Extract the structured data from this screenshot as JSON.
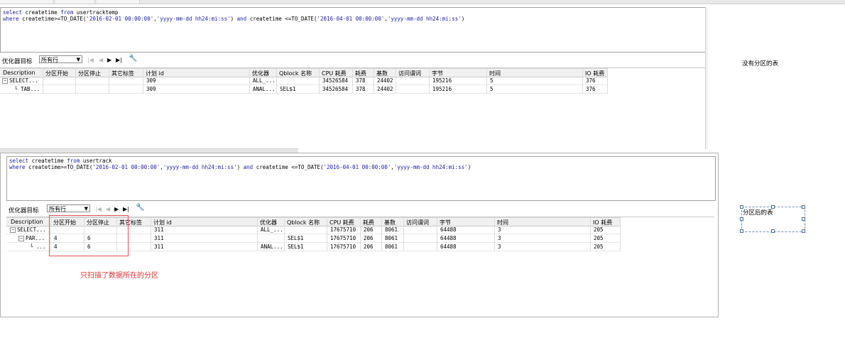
{
  "panel1": {
    "sql": {
      "line1": {
        "kw1": "select",
        "rest": " createtime ",
        "kw2": "from",
        "rest2": " usertracktemp"
      },
      "line2": {
        "kw1": "where",
        "rest": " createtime>=TO_DATE(",
        "s1": "'2016-02-01 00:00:00'",
        "c": ",",
        "s2": "'yyyy-mm-dd hh24:mi:ss'",
        "mid": ") ",
        "kw2": "and",
        "rest2": " createtime <=TO_DATE(",
        "s3": "'2016-04-01 00:00:00'",
        "c2": ",",
        "s4": "'yyyy-mm-dd hh24:mi:ss'",
        "end": ")"
      }
    },
    "toolbar": {
      "label": "优化器目标",
      "selected": "所有行"
    },
    "columns": [
      "Description",
      "分区开始",
      "分区停止",
      "其它标签",
      "计划 id",
      "优化器",
      "Qblock 名称",
      "CPU 耗费",
      "耗费",
      "基数",
      "访问谓词",
      "字节",
      "时间",
      "IO 耗费"
    ],
    "rows": [
      {
        "desc": "SELECT...",
        "start": "",
        "stop": "",
        "other": "",
        "planid": "309",
        "optimizer": "ALL_...",
        "qblock": "",
        "cpu": "34526584",
        "cost": "378",
        "card": "24402",
        "access": "",
        "bytes": "195216",
        "time": "5",
        "io": "376"
      },
      {
        "desc": "TAB...",
        "start": "",
        "stop": "",
        "other": "",
        "planid": "309",
        "optimizer": "ANAL...",
        "qblock": "SEL$1",
        "cpu": "34526584",
        "cost": "378",
        "card": "24402",
        "access": "",
        "bytes": "195216",
        "time": "5",
        "io": "376"
      }
    ],
    "side_note": "没有分区的表"
  },
  "panel2": {
    "sql": {
      "line1": {
        "kw1": "select",
        "rest": " createtime ",
        "kw2": "from",
        "rest2": " usertrack"
      },
      "line2": {
        "kw1": "where",
        "rest": " createtime>=TO_DATE(",
        "s1": "'2016-02-01 00:00:00'",
        "c": ",",
        "s2": "'yyyy-mm-dd hh24:mi:ss'",
        "mid": ") ",
        "kw2": "and",
        "rest2": " createtime <=TO_DATE(",
        "s3": "'2016-04-01 00:00:00'",
        "c2": ",",
        "s4": "'yyyy-mm-dd hh24:mi:ss'",
        "end": ")"
      }
    },
    "toolbar": {
      "label": "优化器目标",
      "selected": "所有行"
    },
    "columns": [
      "Description",
      "分区开始",
      "分区停止",
      "其它标签",
      "计划 id",
      "优化器",
      "Qblock 名称",
      "CPU 耗费",
      "耗费",
      "基数",
      "访问谓词",
      "字节",
      "时间",
      "IO 耗费"
    ],
    "rows": [
      {
        "desc": "SELECT...",
        "start": "",
        "stop": "",
        "other": "",
        "planid": "311",
        "optimizer": "ALL_...",
        "qblock": "",
        "cpu": "17675710",
        "cost": "206",
        "card": "8061",
        "access": "",
        "bytes": "64488",
        "time": "3",
        "io": "205"
      },
      {
        "desc": "PAR...",
        "start": "4",
        "stop": "6",
        "other": "",
        "planid": "311",
        "optimizer": "",
        "qblock": "SEL$1",
        "cpu": "17675710",
        "cost": "206",
        "card": "8061",
        "access": "",
        "bytes": "64488",
        "time": "3",
        "io": "205"
      },
      {
        "desc": "...",
        "start": "4",
        "stop": "6",
        "other": "",
        "planid": "311",
        "optimizer": "ANAL...",
        "qblock": "SEL$1",
        "cpu": "17675710",
        "cost": "206",
        "card": "8061",
        "access": "",
        "bytes": "64488",
        "time": "3",
        "io": "205"
      }
    ],
    "annotation": "只扫描了数据所在的分区",
    "side_note": "分区后的表"
  },
  "icons": {
    "first": "|◀",
    "prev": "◀",
    "next": "▶",
    "last": "▶|",
    "wrench": "wrench-icon"
  },
  "colors": {
    "keyword": "#1a1aa6",
    "annotation": "#e03030",
    "redbox": "#e05050"
  }
}
